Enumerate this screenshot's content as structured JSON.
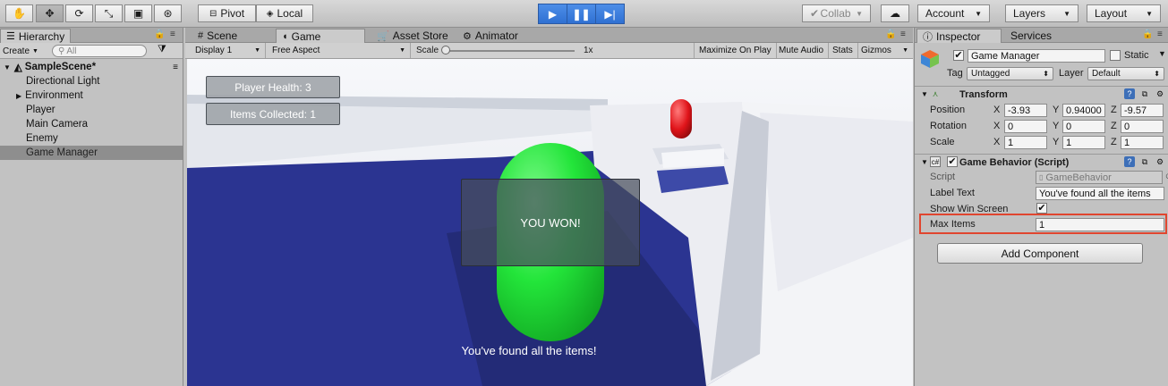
{
  "toolbar": {
    "pivot_label": "Pivot",
    "local_label": "Local",
    "collab_label": "Collab",
    "account_label": "Account",
    "layers_label": "Layers",
    "layout_label": "Layout"
  },
  "hierarchy": {
    "tab_label": "Hierarchy",
    "create_label": "Create",
    "search_placeholder": "All",
    "scene_name": "SampleScene*",
    "items": [
      {
        "label": "Directional Light"
      },
      {
        "label": "Environment"
      },
      {
        "label": "Player"
      },
      {
        "label": "Main Camera"
      },
      {
        "label": "Enemy"
      },
      {
        "label": "Game Manager"
      }
    ]
  },
  "center_tabs": {
    "scene": "Scene",
    "game": "Game",
    "asset_store": "Asset Store",
    "animator": "Animator"
  },
  "game_toolbar": {
    "display": "Display 1",
    "aspect": "Free Aspect",
    "scale_label": "Scale",
    "scale_value": "1x",
    "maximize": "Maximize On Play",
    "mute": "Mute Audio",
    "stats": "Stats",
    "gizmos": "Gizmos"
  },
  "game_ui": {
    "player_health": "Player Health: 3",
    "items_collected": "Items Collected: 1",
    "win_button": "YOU WON!",
    "found_text": "You've found all the items!"
  },
  "inspector": {
    "tab_label": "Inspector",
    "services_label": "Services",
    "object_name": "Game Manager",
    "static_label": "Static",
    "tag_label": "Tag",
    "tag_value": "Untagged",
    "layer_label": "Layer",
    "layer_value": "Default",
    "transform": {
      "title": "Transform",
      "position_label": "Position",
      "rotation_label": "Rotation",
      "scale_label": "Scale",
      "x": "X",
      "y": "Y",
      "z": "Z",
      "position": [
        "-3.93",
        "0.94000",
        "-9.57"
      ],
      "rotation": [
        "0",
        "0",
        "0"
      ],
      "scale": [
        "1",
        "1",
        "1"
      ]
    },
    "script_component": {
      "title": "Game Behavior (Script)",
      "script_label": "Script",
      "script_value": "GameBehavior",
      "label_text_label": "Label Text",
      "label_text_value": "You've found all the items",
      "show_win_label": "Show Win Screen",
      "max_items_label": "Max Items",
      "max_items_value": "1"
    },
    "add_component": "Add Component"
  },
  "colors": {
    "play_active": "#3478db",
    "highlight": "#e0452f",
    "capsule_green": "#23e53a",
    "ground_blue": "#2b3491"
  }
}
